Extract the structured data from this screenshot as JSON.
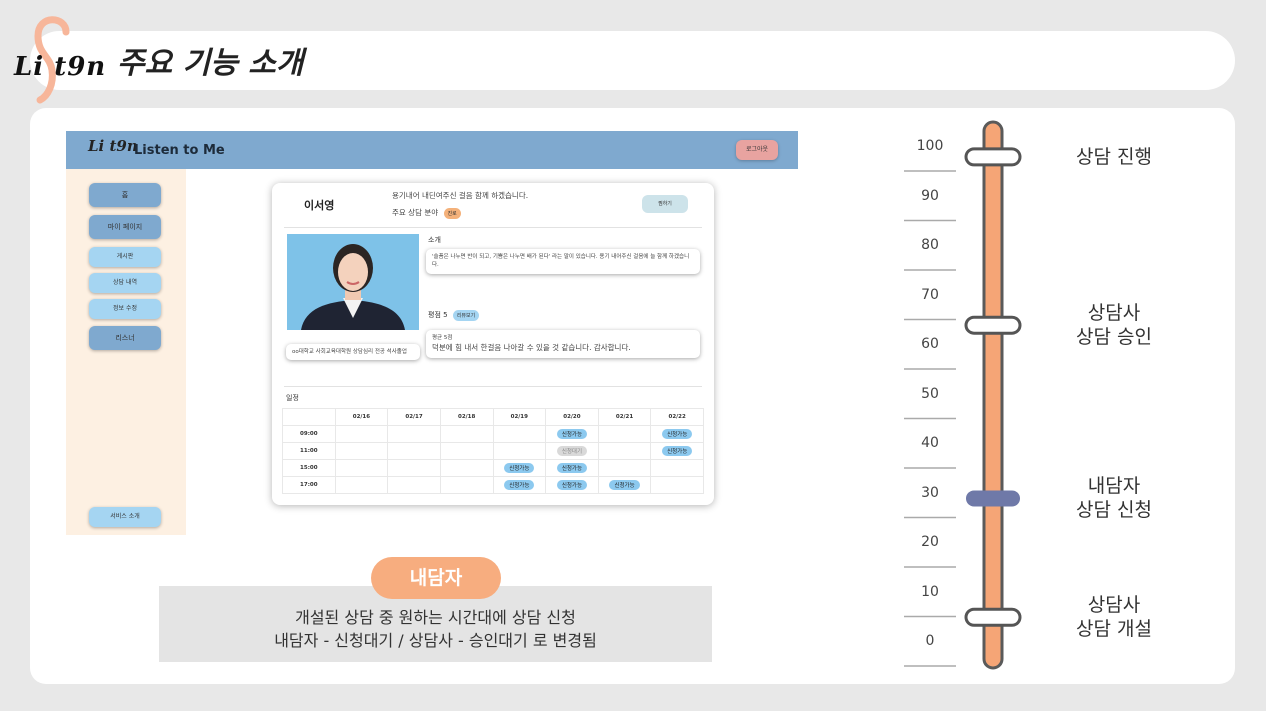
{
  "header": {
    "logo_text": "Li  t9n",
    "title": "주요 기능 소개"
  },
  "app": {
    "logo_text": "Li  t9n",
    "title": "Listen to Me",
    "logout_label": "로그아웃",
    "sidebar": [
      "홈",
      "마이 페이지",
      "게시판",
      "상담 내역",
      "정보 수정",
      "리스너"
    ],
    "sidebar_bottom": "서비스 소개",
    "profile": {
      "name": "이서영",
      "intro": "용기내어 내딘여주신 걸음 함께 하겠습니다.",
      "area_label": "주요 상담 분야",
      "area_tag": "진로",
      "like_button": "찜하기",
      "about_label": "소개",
      "about_text": "'슬픔은 나누면 반이 되고, 기쁨은 나누면 배가 된다' 라는 말이 있습니다. 용기 내어주신 걸음에 늘 함께 하겠습니다.",
      "career_text": "oo대학교 사회교육대학원 상담심리 전공 석사졸업",
      "rating_label": "평점 5",
      "review_tag": "리뷰보기",
      "review_title": "평균 5점",
      "review_text": "덕분에 힘 내서 한걸음 나아갈 수 있을 것 같습니다. 감사합니다.",
      "schedule_label": "일정",
      "dates": [
        "02/16",
        "02/17",
        "02/18",
        "02/19",
        "02/20",
        "02/21",
        "02/22"
      ],
      "times": [
        "09:00",
        "11:00",
        "15:00",
        "17:00"
      ],
      "slots": [
        [
          "",
          "",
          "",
          "",
          "신청가능",
          "",
          "신청가능"
        ],
        [
          "",
          "",
          "",
          "",
          "신청대기",
          "",
          "신청가능"
        ],
        [
          "",
          "",
          "",
          "신청가능",
          "신청가능",
          "",
          ""
        ],
        [
          "",
          "",
          "",
          "신청가능",
          "신청가능",
          "신청가능",
          ""
        ]
      ]
    }
  },
  "caption": {
    "role": "내담자",
    "line1": "개설된 상담 중 원하는 시간대에 상담 신청",
    "line2": "내담자 - 신청대기 / 상담사 - 승인대기 로 변경됨"
  },
  "scale": {
    "ticks": [
      "100",
      "90",
      "80",
      "70",
      "60",
      "50",
      "40",
      "30",
      "20",
      "10",
      "0"
    ],
    "track_color": "#f5a576",
    "active_handle_color": "#6f79a8",
    "steps": [
      {
        "value": 98,
        "lines": [
          "상담 진행"
        ],
        "active": false
      },
      {
        "value": 64,
        "lines": [
          "상담사",
          "상담 승인"
        ],
        "active": false
      },
      {
        "value": 29,
        "lines": [
          "내담자",
          "상담 신청"
        ],
        "active": true
      },
      {
        "value": 5,
        "lines": [
          "상담사",
          "상담 개설"
        ],
        "active": false
      }
    ]
  }
}
